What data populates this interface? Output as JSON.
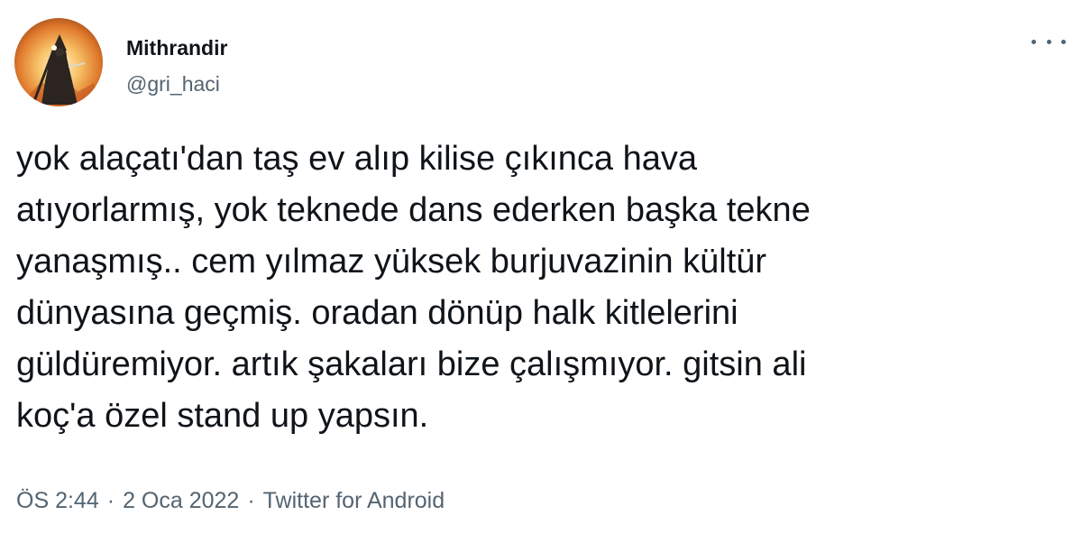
{
  "tweet": {
    "author": {
      "display_name": "Mithrandir",
      "handle": "@gri_haci"
    },
    "text": "yok alaçatı'dan taş ev alıp kilise çıkınca hava\natıyorlarmış, yok teknede dans ederken başka tekne\nyanaşmış.. cem yılmaz yüksek burjuvazinin kültür\ndünyasına geçmiş. oradan dönüp halk kitlelerini\ngüldüremiyor. artık şakaları bize çalışmıyor. gitsin ali\nkoç'a özel stand up yapsın.",
    "time": "ÖS 2:44",
    "date": "2 Oca 2022",
    "source": "Twitter for Android",
    "separator": "·"
  },
  "icons": {
    "avatar": "wizard-avatar",
    "more": "more-options-icon"
  },
  "colors": {
    "text_primary": "#0f1419",
    "text_secondary": "#536471",
    "background": "#ffffff"
  }
}
